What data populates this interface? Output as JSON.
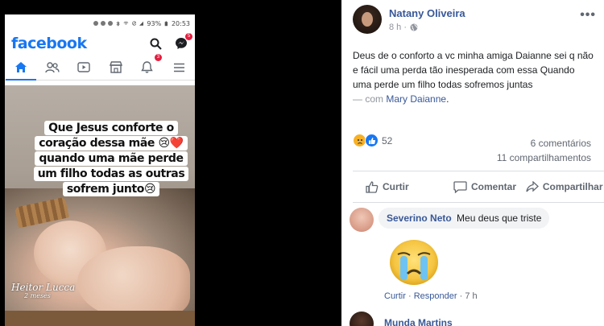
{
  "phone": {
    "status": {
      "battery": "93%",
      "time": "20:53"
    },
    "app_name": "facebook",
    "notif_badges": {
      "messenger": "5",
      "notifications": "3"
    },
    "image_caption": [
      "Que Jesus conforte o",
      "coração dessa mãe 😢❤️",
      "quando uma mãe perde",
      "um filho todas as outras",
      "sofrem junto😢"
    ],
    "signature_line1": "Heitor Lucca",
    "signature_line2": "2 meses"
  },
  "post": {
    "author": "Natany Oliveira",
    "time": "8 h ·",
    "text_main": "Deus de o conforto a vc minha amiga Daianne sei q não e fácil uma perda tão inesperada com essa Quando uma perde um filho todas sofremos juntas",
    "with_prefix": "— com",
    "tagged": "Mary Daianne",
    "text_end": ".",
    "reaction_count": "52",
    "comments_count": "6 comentários",
    "shares_count": "11 compartilhamentos",
    "actions": {
      "like": "Curtir",
      "comment": "Comentar",
      "share": "Compartilhar"
    }
  },
  "comments": [
    {
      "author": "Severino Neto",
      "text": "Meu deus que triste",
      "like_label": "Curtir",
      "reply_label": "Responder",
      "separator": "·",
      "time": "7 h"
    },
    {
      "author": "Munda Martins"
    }
  ],
  "icons": {
    "search": "search-icon",
    "messenger": "messenger-icon",
    "home": "home-icon",
    "friends": "friends-icon",
    "watch": "video-icon",
    "marketplace": "marketplace-icon",
    "notifications": "bell-icon",
    "menu": "menu-icon",
    "more": "more-icon",
    "globe": "globe-icon"
  },
  "colors": {
    "facebook_blue": "#1877f2",
    "link": "#385898",
    "muted": "#606770",
    "sad_yellow": "#f7b125"
  }
}
